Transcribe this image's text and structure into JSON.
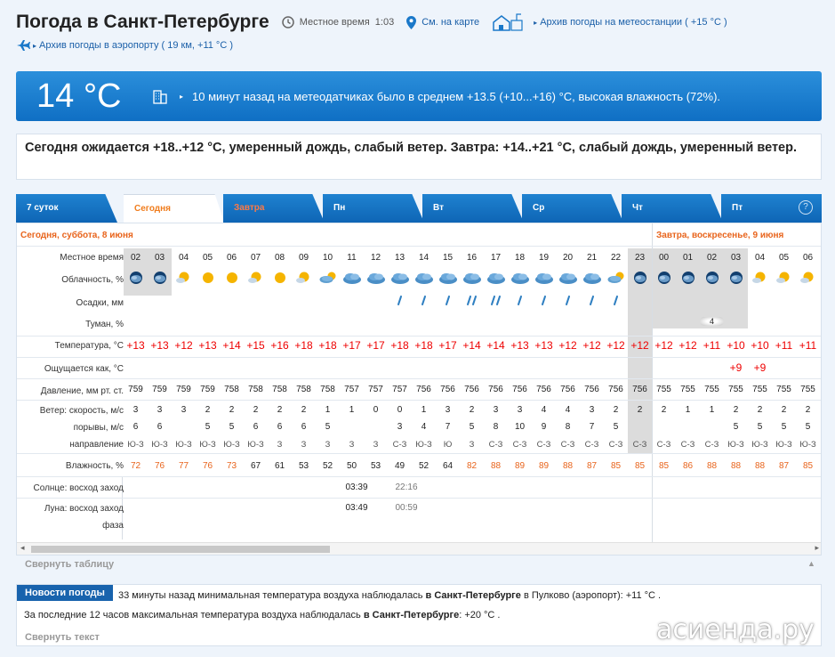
{
  "header": {
    "title": "Погода в Санкт-Петербурге",
    "local_time_label": "Местное время",
    "local_time": "1:03",
    "map_link": "См. на карте",
    "archive_station": "Архив погоды на метеостанции ( +15 °C )",
    "archive_airport": "Архив погоды в аэропорту ( 19 км, +11 °C )"
  },
  "current": {
    "temp": "14 °C",
    "text": "10 минут назад на метеодатчиках было в среднем +13.5 (+10...+16) °C, высокая влажность (72%)."
  },
  "forecast_text": "Сегодня ожидается +18..+12 °C, умеренный дождь, слабый ветер. Завтра: +14..+21 °C, слабый дождь, умеренный ветер.",
  "tabs": [
    "7 суток",
    "Сегодня",
    "Завтра",
    "Пн",
    "Вт",
    "Ср",
    "Чт",
    "Пт"
  ],
  "day_labels": {
    "today": "Сегодня, суббота, 8 июня",
    "tomorrow": "Завтра, воскресенье, 9 июня"
  },
  "row_labels": {
    "time": "Местное время",
    "cloud": "Облачность, %",
    "precip": "Осадки, мм",
    "fog": "Туман, %",
    "temp": "Температура, °C",
    "feels": "Ощущается как, °C",
    "pressure": "Давление, мм рт. ст.",
    "wind_speed": "Ветер: скорость, м/с",
    "gusts": "порывы, м/с",
    "direction": "направление",
    "humidity": "Влажность, %",
    "sun": "Солнце: восход  заход",
    "moon": "Луна: восход  заход",
    "phase": "фаза"
  },
  "hours": [
    "02",
    "03",
    "04",
    "05",
    "06",
    "07",
    "08",
    "09",
    "10",
    "11",
    "12",
    "13",
    "14",
    "15",
    "16",
    "17",
    "18",
    "19",
    "20",
    "21",
    "22",
    "23",
    "00",
    "01",
    "02",
    "03",
    "04",
    "05",
    "06"
  ],
  "cloud_icons": [
    "night-cloud",
    "night-cloud",
    "sun-cloud",
    "sun",
    "sun",
    "sun-cloud",
    "sun",
    "sun-cloud",
    "partly",
    "cloud",
    "cloud",
    "cloud",
    "cloud",
    "cloud",
    "cloud",
    "cloud",
    "cloud",
    "cloud",
    "cloud",
    "cloud",
    "partly",
    "night-cloud",
    "night-cloud",
    "night-cloud",
    "night-cloud",
    "night-cloud",
    "sun-cloud",
    "sun-cloud",
    "sun-cloud"
  ],
  "precip_icons": [
    "",
    "",
    "",
    "",
    "",
    "",
    "",
    "",
    "",
    "",
    "",
    "drop",
    "drop",
    "drop",
    "drops",
    "drops",
    "drop",
    "drop",
    "drop",
    "drop",
    "drop",
    "",
    "",
    "",
    "",
    "",
    "",
    "",
    ""
  ],
  "fog": [
    "",
    "",
    "",
    "",
    "",
    "",
    "",
    "",
    "",
    "",
    "",
    "",
    "",
    "",
    "",
    "",
    "",
    "",
    "",
    "",
    "",
    "",
    "",
    "",
    "4",
    "",
    "",
    "",
    ""
  ],
  "temps": [
    "+13",
    "+13",
    "+12",
    "+13",
    "+14",
    "+15",
    "+16",
    "+18",
    "+18",
    "+17",
    "+17",
    "+18",
    "+18",
    "+17",
    "+14",
    "+14",
    "+13",
    "+13",
    "+12",
    "+12",
    "+12",
    "+12",
    "+12",
    "+12",
    "+11",
    "+10",
    "+10",
    "+11",
    "+11"
  ],
  "feels": [
    "",
    "",
    "",
    "",
    "",
    "",
    "",
    "",
    "",
    "",
    "",
    "",
    "",
    "",
    "",
    "",
    "",
    "",
    "",
    "",
    "",
    "",
    "",
    "",
    "",
    "+9",
    "+9",
    "",
    ""
  ],
  "pressure": [
    "759",
    "759",
    "759",
    "759",
    "758",
    "758",
    "758",
    "758",
    "758",
    "757",
    "757",
    "757",
    "756",
    "756",
    "756",
    "756",
    "756",
    "756",
    "756",
    "756",
    "756",
    "756",
    "755",
    "755",
    "755",
    "755",
    "755",
    "755",
    "755"
  ],
  "wind": [
    "3",
    "3",
    "3",
    "2",
    "2",
    "2",
    "2",
    "2",
    "1",
    "1",
    "0",
    "0",
    "1",
    "3",
    "2",
    "3",
    "3",
    "4",
    "4",
    "3",
    "2",
    "2",
    "2",
    "1",
    "1",
    "2",
    "2",
    "2",
    "2"
  ],
  "gusts": [
    "6",
    "6",
    "",
    "5",
    "5",
    "6",
    "6",
    "6",
    "5",
    "",
    "",
    "3",
    "4",
    "7",
    "5",
    "8",
    "10",
    "9",
    "8",
    "7",
    "5",
    "",
    "",
    "",
    "",
    "5",
    "5",
    "5",
    "5"
  ],
  "direction": [
    "Ю-З",
    "Ю-З",
    "Ю-З",
    "Ю-З",
    "Ю-З",
    "Ю-З",
    "З",
    "З",
    "З",
    "З",
    "З",
    "С-З",
    "Ю-З",
    "Ю",
    "З",
    "С-З",
    "С-З",
    "С-З",
    "С-З",
    "С-З",
    "С-З",
    "С-З",
    "С-З",
    "С-З",
    "С-З",
    "Ю-З",
    "Ю-З",
    "Ю-З",
    "Ю-З"
  ],
  "humidity": [
    "72",
    "76",
    "77",
    "76",
    "73",
    "67",
    "61",
    "53",
    "52",
    "50",
    "53",
    "49",
    "52",
    "64",
    "82",
    "88",
    "89",
    "89",
    "88",
    "87",
    "85",
    "85",
    "85",
    "86",
    "88",
    "88",
    "88",
    "87",
    "85"
  ],
  "sun": {
    "rise": "03:39",
    "set": "22:16"
  },
  "moon": {
    "rise": "03:49",
    "set": "00:59"
  },
  "collapse_table": "Свернуть таблицу",
  "news": {
    "tag": "Новости погоды",
    "l1_pre": "33 минуты назад минимальная температура воздуха наблюдалась",
    "l1_city": "в Санкт-Петербурге",
    "l1_post": "в Пулково (аэропорт): +11 °C .",
    "l2_pre": "За последние 12 часов максимальная температура воздуха наблюдалась",
    "l2_city": "в Санкт-Петербурге",
    "l2_post": ": +20 °C .",
    "collapse": "Свернуть текст"
  },
  "watermark": "асиенда.ру",
  "colors": {
    "accent": "#0f6fc4",
    "orange": "#e8641c",
    "temp_red": "#e00000"
  }
}
